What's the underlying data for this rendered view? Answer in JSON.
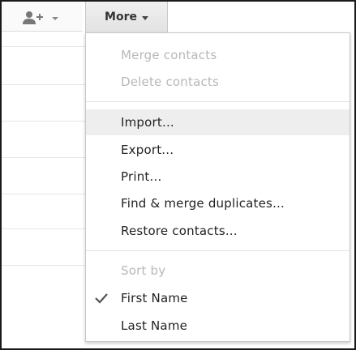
{
  "toolbar": {
    "add_contact_icon": "add-person-icon",
    "more_label": "More"
  },
  "menu": {
    "group1": [
      {
        "label": "Merge contacts",
        "disabled": true
      },
      {
        "label": "Delete contacts",
        "disabled": true
      }
    ],
    "group2": [
      {
        "label": "Import...",
        "highlighted": true
      },
      {
        "label": "Export..."
      },
      {
        "label": "Print..."
      },
      {
        "label": "Find & merge duplicates..."
      },
      {
        "label": "Restore contacts..."
      }
    ],
    "sort_header": "Sort by",
    "sort_options": [
      {
        "label": "First Name",
        "checked": true
      },
      {
        "label": "Last Name",
        "checked": false
      }
    ]
  },
  "colors": {
    "disabled_text": "#b8b8b8",
    "highlight_bg": "#eeeeee",
    "check_color": "#555555"
  }
}
